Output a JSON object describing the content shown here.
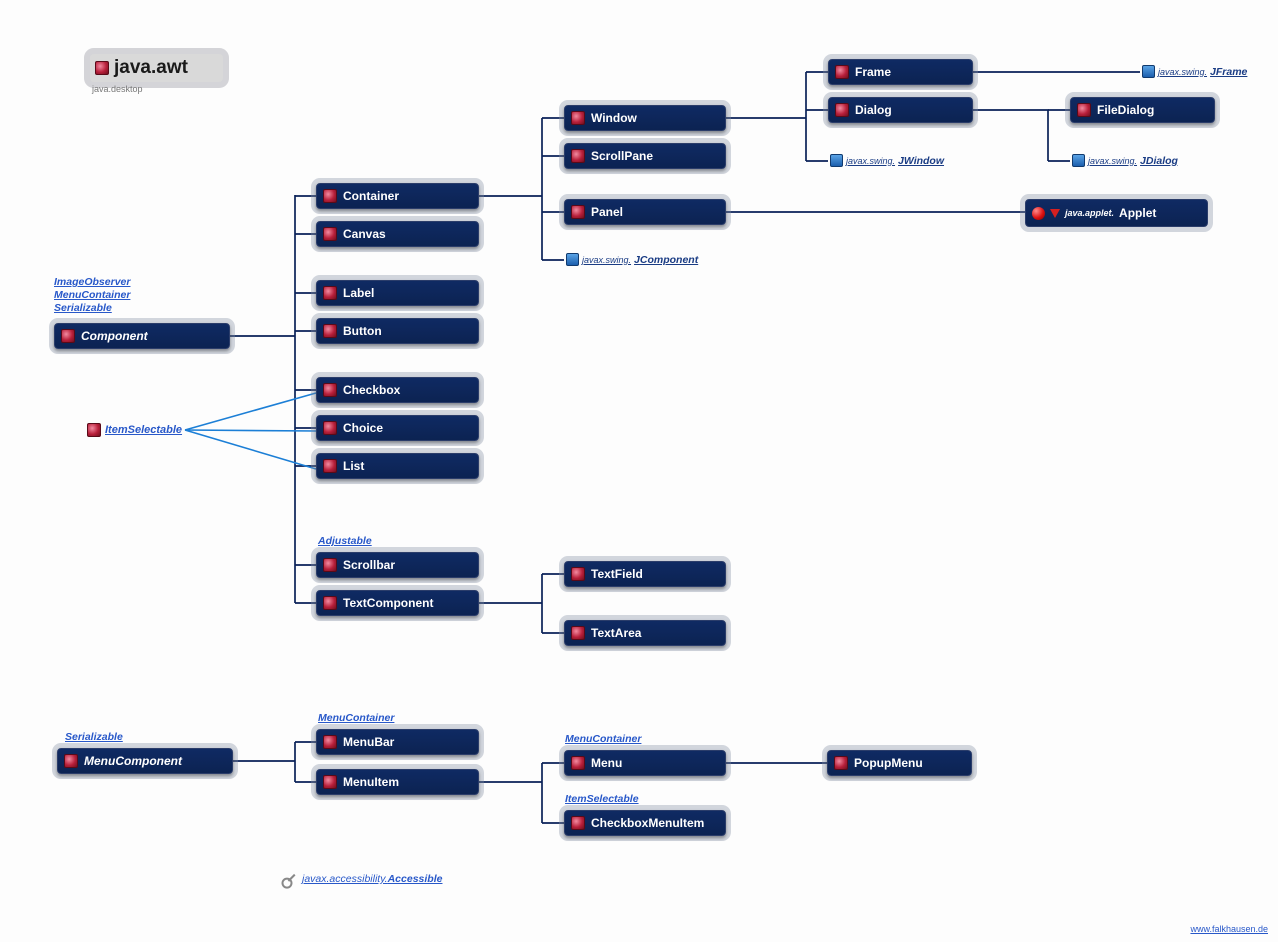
{
  "header": {
    "title": "java.awt",
    "subtitle": "java.desktop"
  },
  "interfaces": {
    "component_impl": "ImageObserver\nMenuContainer\nSerializable",
    "item_selectable": "ItemSelectable",
    "adjustable": "Adjustable",
    "menu_container_1": "MenuContainer",
    "menu_container_2": "MenuContainer",
    "item_selectable_2": "ItemSelectable",
    "serializable_2": "Serializable",
    "accessible_pkg": "javax.accessibility.",
    "accessible": "Accessible"
  },
  "ext": {
    "jcomponent_pkg": "javax.swing.",
    "jcomponent": "JComponent",
    "jwindow_pkg": "javax.swing.",
    "jwindow": "JWindow",
    "jframe_pkg": "javax.swing.",
    "jframe": "JFrame",
    "jdialog_pkg": "javax.swing.",
    "jdialog": "JDialog"
  },
  "nodes": {
    "component": "Component",
    "container": "Container",
    "canvas": "Canvas",
    "label": "Label",
    "button": "Button",
    "checkbox": "Checkbox",
    "choice": "Choice",
    "list": "List",
    "scrollbar": "Scrollbar",
    "textcomponent": "TextComponent",
    "window": "Window",
    "scrollpane": "ScrollPane",
    "panel": "Panel",
    "textfield": "TextField",
    "textarea": "TextArea",
    "frame": "Frame",
    "dialog": "Dialog",
    "filedialog": "FileDialog",
    "menucomponent": "MenuComponent",
    "menubar": "MenuBar",
    "menuitem": "MenuItem",
    "menu": "Menu",
    "checkboxmenuitem": "CheckboxMenuItem",
    "popupmenu": "PopupMenu"
  },
  "applet": {
    "pkg": "java.applet.",
    "name": "Applet"
  },
  "watermark": "www.falkhausen.de",
  "chart_data": {
    "type": "class-hierarchy",
    "package": "java.awt",
    "module": "java.desktop",
    "roots": [
      {
        "name": "Component",
        "abstract": true,
        "implements": [
          "ImageObserver",
          "MenuContainer",
          "Serializable"
        ],
        "children": [
          {
            "name": "Container",
            "children": [
              {
                "name": "Window",
                "children": [
                  {
                    "name": "Frame",
                    "extended_by_external": [
                      "javax.swing.JFrame"
                    ]
                  },
                  {
                    "name": "Dialog",
                    "children": [
                      {
                        "name": "FileDialog"
                      }
                    ],
                    "extended_by_external": [
                      "javax.swing.JDialog"
                    ]
                  }
                ],
                "extended_by_external": [
                  "javax.swing.JWindow"
                ]
              },
              {
                "name": "ScrollPane"
              },
              {
                "name": "Panel",
                "children": [
                  {
                    "name": "java.applet.Applet",
                    "external": true
                  }
                ]
              }
            ],
            "extended_by_external": [
              "javax.swing.JComponent"
            ]
          },
          {
            "name": "Canvas"
          },
          {
            "name": "Label"
          },
          {
            "name": "Button"
          },
          {
            "name": "Checkbox",
            "implements": [
              "ItemSelectable"
            ]
          },
          {
            "name": "Choice",
            "implements": [
              "ItemSelectable"
            ]
          },
          {
            "name": "List",
            "implements": [
              "ItemSelectable"
            ]
          },
          {
            "name": "Scrollbar",
            "implements": [
              "Adjustable"
            ]
          },
          {
            "name": "TextComponent",
            "children": [
              {
                "name": "TextField"
              },
              {
                "name": "TextArea"
              }
            ]
          }
        ]
      },
      {
        "name": "MenuComponent",
        "abstract": true,
        "implements": [
          "Serializable"
        ],
        "children": [
          {
            "name": "MenuBar",
            "implements": [
              "MenuContainer"
            ]
          },
          {
            "name": "MenuItem",
            "children": [
              {
                "name": "Menu",
                "implements": [
                  "MenuContainer"
                ],
                "children": [
                  {
                    "name": "PopupMenu"
                  }
                ]
              },
              {
                "name": "CheckboxMenuItem",
                "implements": [
                  "ItemSelectable"
                ]
              }
            ]
          }
        ]
      }
    ],
    "all_implement": "javax.accessibility.Accessible"
  }
}
